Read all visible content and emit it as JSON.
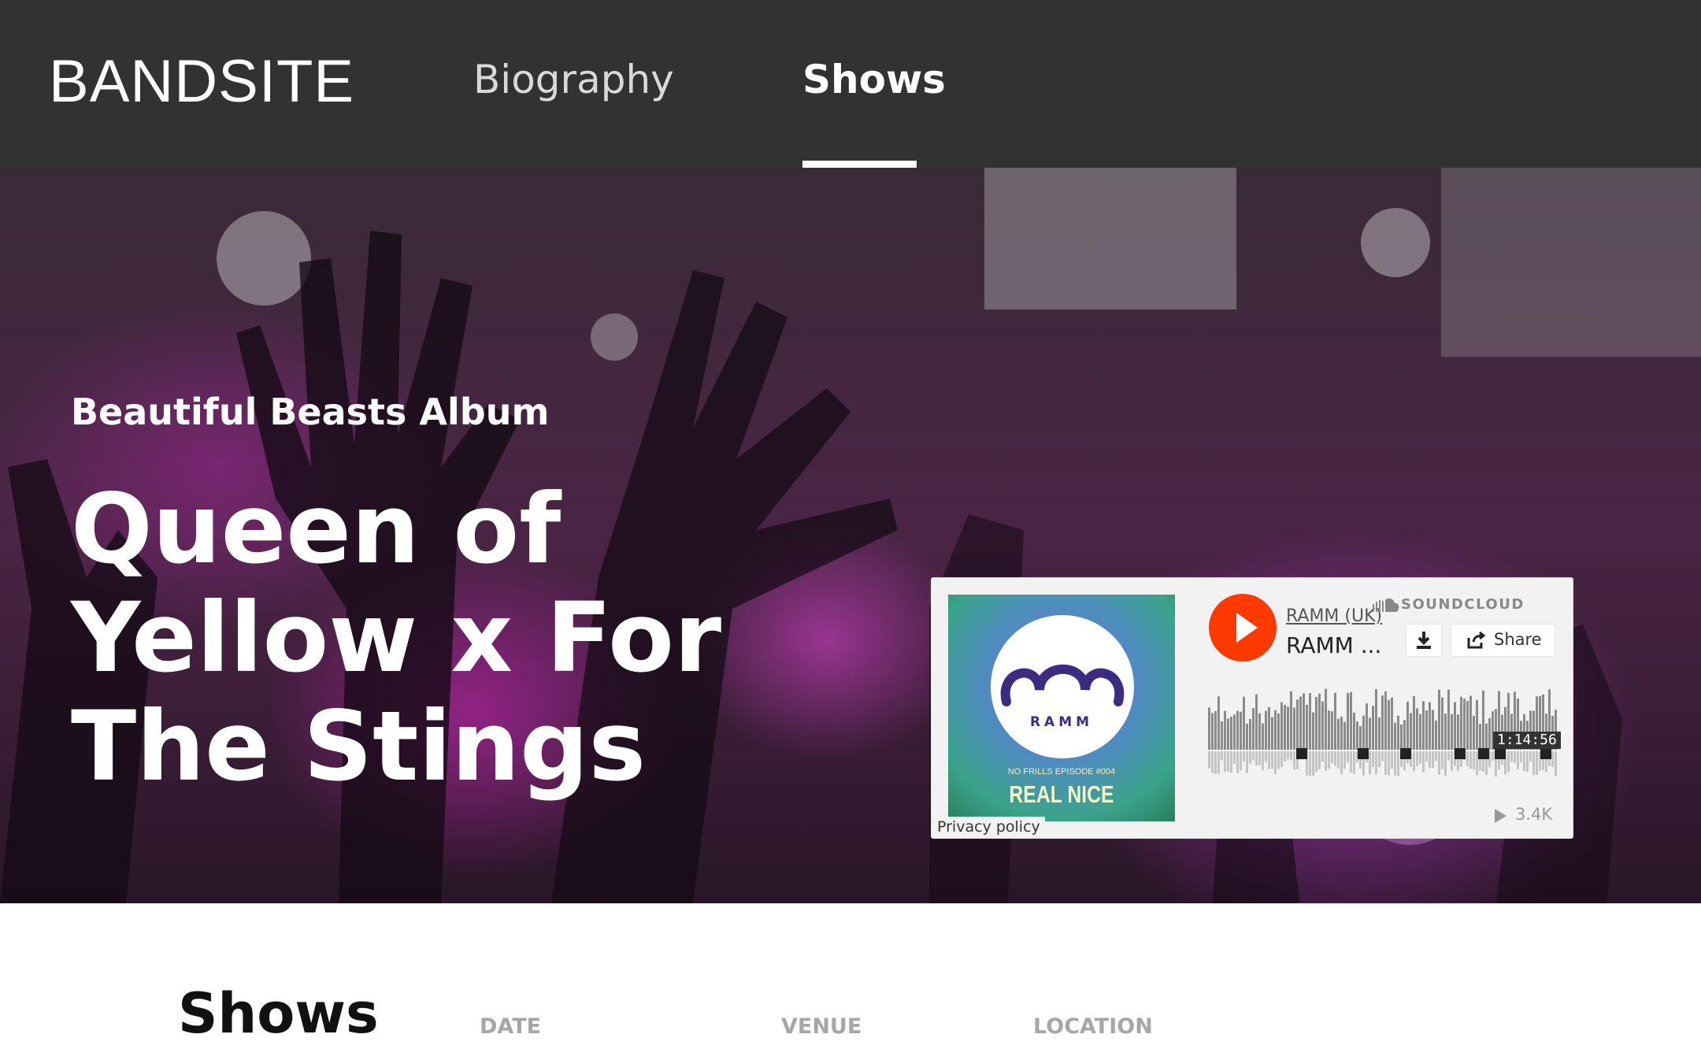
{
  "header": {
    "logo": "BANDSITE",
    "nav": [
      {
        "label": "Biography",
        "active": false
      },
      {
        "label": "Shows",
        "active": true
      }
    ]
  },
  "hero": {
    "subtitle": "Beautiful Beasts Album",
    "title": "Queen of Yellow x For The Stings"
  },
  "player": {
    "brand": "SOUNDCLOUD",
    "user": "RAMM (UK)",
    "track": "RAMM ...",
    "artwork": {
      "logo_text": "RAMM",
      "episode_text": "NO FRILLS EPISODE #004",
      "release_text": "REAL NICE"
    },
    "share_label": "Share",
    "duration": "1:14:56",
    "plays": "3.4K",
    "privacy_label": "Privacy policy",
    "accent_color": "#ff3a00",
    "icons": [
      "play-icon",
      "soundcloud-cloud-icon",
      "download-icon",
      "share-icon",
      "play-count-icon"
    ]
  },
  "shows": {
    "title": "Shows",
    "columns": [
      "DATE",
      "VENUE",
      "LOCATION"
    ]
  }
}
